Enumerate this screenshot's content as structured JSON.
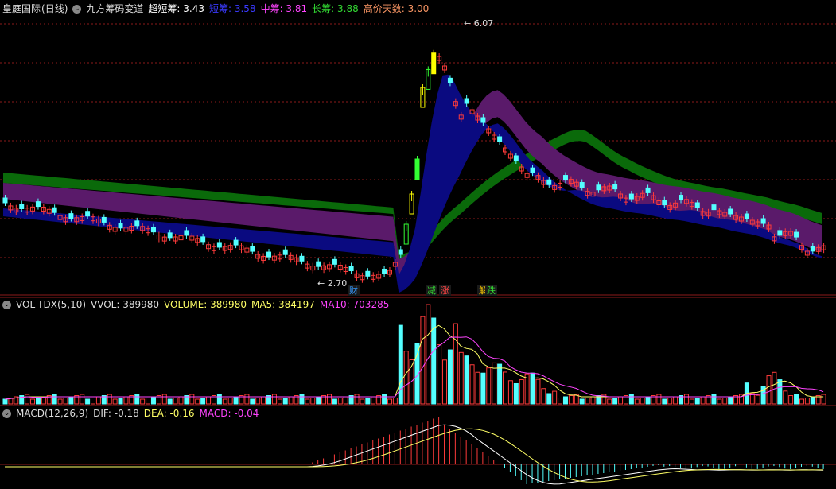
{
  "main": {
    "stock_name": "皇庭国际",
    "period": "(日线)",
    "indicator_name": "九方筹码变道",
    "items": [
      {
        "label": "超短筹:",
        "value": "3.43",
        "color": "#ffffff"
      },
      {
        "label": "短筹:",
        "value": "3.58",
        "color": "#3a3aff"
      },
      {
        "label": "中筹:",
        "value": "3.81",
        "color": "#ff44ff"
      },
      {
        "label": "长筹:",
        "value": "3.88",
        "color": "#33dd33"
      },
      {
        "label": "高价天数:",
        "value": "3.00",
        "color": "#ff9966"
      }
    ],
    "high_label": "6.07",
    "low_label": "2.70",
    "markers": [
      {
        "text": "财",
        "color": "#3399ff"
      },
      {
        "text": "减",
        "color": "#33dd33"
      },
      {
        "text": "涨",
        "color": "#ff4444"
      },
      {
        "text": "解",
        "color": "#ffcc00"
      },
      {
        "text": "跌",
        "color": "#33dd33"
      }
    ]
  },
  "volume": {
    "title": "VOL-TDX(5,10)",
    "items": [
      {
        "label": "VVOL:",
        "value": "389980",
        "color": "#dddddd"
      },
      {
        "label": "VOLUME:",
        "value": "389980",
        "color": "#ffff66"
      },
      {
        "label": "MA5:",
        "value": "384197",
        "color": "#ffff66"
      },
      {
        "label": "MA10:",
        "value": "703285",
        "color": "#ff44ff"
      }
    ]
  },
  "macd": {
    "title": "MACD(12,26,9)",
    "items": [
      {
        "label": "DIF:",
        "value": "-0.18",
        "color": "#dddddd"
      },
      {
        "label": "DEA:",
        "value": "-0.16",
        "color": "#ffff66"
      },
      {
        "label": "MACD:",
        "value": "-0.04",
        "color": "#ff44ff"
      }
    ]
  },
  "colors": {
    "up": "#ff3b3b",
    "down": "#54ffff",
    "grid": "#8b1a1a",
    "band_green": "#0a6a0a",
    "band_purple": "#5a1a6a",
    "band_blue": "#0a0a80"
  }
}
